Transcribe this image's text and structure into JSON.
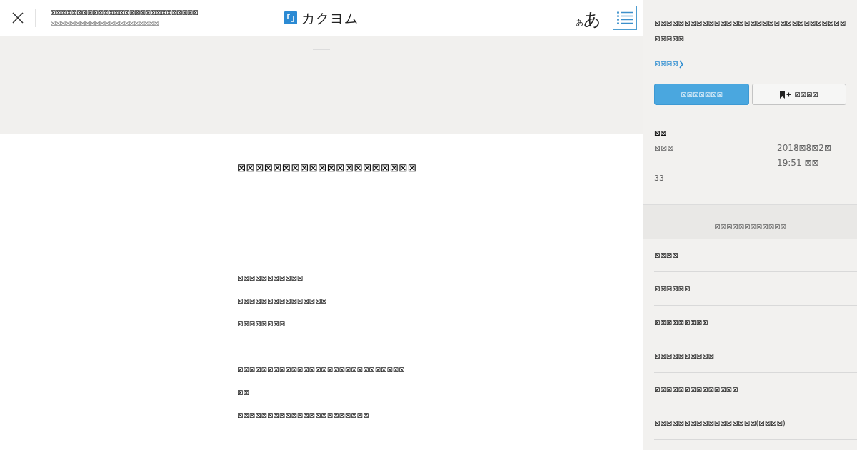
{
  "header": {
    "title": "⊠⊠⊠⊠⊠⊠⊠⊠⊠⊠⊠⊠⊠⊠⊠⊠⊠⊠⊠⊠⊠⊠⊠⊠⊠⊠⊠⊠",
    "subtitle": "⊠⊠⊠⊠⊠⊠⊠⊠⊠⊠⊠⊠⊠⊠⊠⊠⊠⊠⊠⊠⊠⊠",
    "logo": {
      "text": "カクヨム"
    },
    "font_button": {
      "small_label": "あ",
      "large_label": "あ"
    },
    "toc_button": {
      "active": true
    }
  },
  "episode": {
    "title": "⊠⊠⊠⊠⊠⊠⊠⊠⊠⊠⊠⊠⊠⊠⊠⊠⊠⊠⊠⊠",
    "paragraphs": [
      [
        "⊠⊠⊠⊠⊠⊠⊠⊠⊠⊠⊠",
        "⊠⊠⊠⊠⊠⊠⊠⊠⊠⊠⊠⊠⊠⊠⊠",
        "⊠⊠⊠⊠⊠⊠⊠⊠"
      ],
      [
        "⊠⊠⊠⊠⊠⊠⊠⊠⊠⊠⊠⊠⊠⊠⊠⊠⊠⊠⊠⊠⊠⊠⊠⊠⊠⊠⊠⊠",
        "⊠⊠",
        "⊠⊠⊠⊠⊠⊠⊠⊠⊠⊠⊠⊠⊠⊠⊠⊠⊠⊠⊠⊠⊠⊠"
      ]
    ]
  },
  "sidebar": {
    "work_title": "⊠⊠⊠⊠⊠⊠⊠⊠⊠⊠⊠⊠⊠⊠⊠⊠⊠⊠⊠⊠⊠⊠⊠⊠⊠⊠⊠⊠⊠⊠⊠⊠⊠⊠⊠⊠⊠",
    "author_link": "⊠⊠⊠⊠",
    "buttons": [
      {
        "kind": "primary",
        "label": "⊠⊠⊠⊠⊠⊠⊠"
      },
      {
        "kind": "bookmark",
        "label": "⊠⊠⊠⊠"
      }
    ],
    "heading": "⊠⊠",
    "details": [
      {
        "label": "⊠⊠⊠",
        "value_lines": [
          "2018⊠8⊠2⊠",
          "19:51 ⊠⊠"
        ]
      },
      {
        "label": "33"
      }
    ],
    "list_heading": "⊠⊠⊠⊠⊠⊠⊠⊠⊠⊠⊠⊠",
    "episodes": [
      {
        "title": "⊠⊠⊠⊠"
      },
      {
        "title": "⊠⊠⊠⊠⊠⊠"
      },
      {
        "title": "⊠⊠⊠⊠⊠⊠⊠⊠⊠"
      },
      {
        "title": "⊠⊠⊠⊠⊠⊠⊠⊠⊠⊠"
      },
      {
        "title": "⊠⊠⊠⊠⊠⊠⊠⊠⊠⊠⊠⊠⊠⊠"
      },
      {
        "title": "⊠⊠⊠⊠⊠⊠⊠⊠⊠⊠⊠⊠⊠⊠⊠⊠⊠(⊠⊠⊠⊠)"
      }
    ]
  }
}
